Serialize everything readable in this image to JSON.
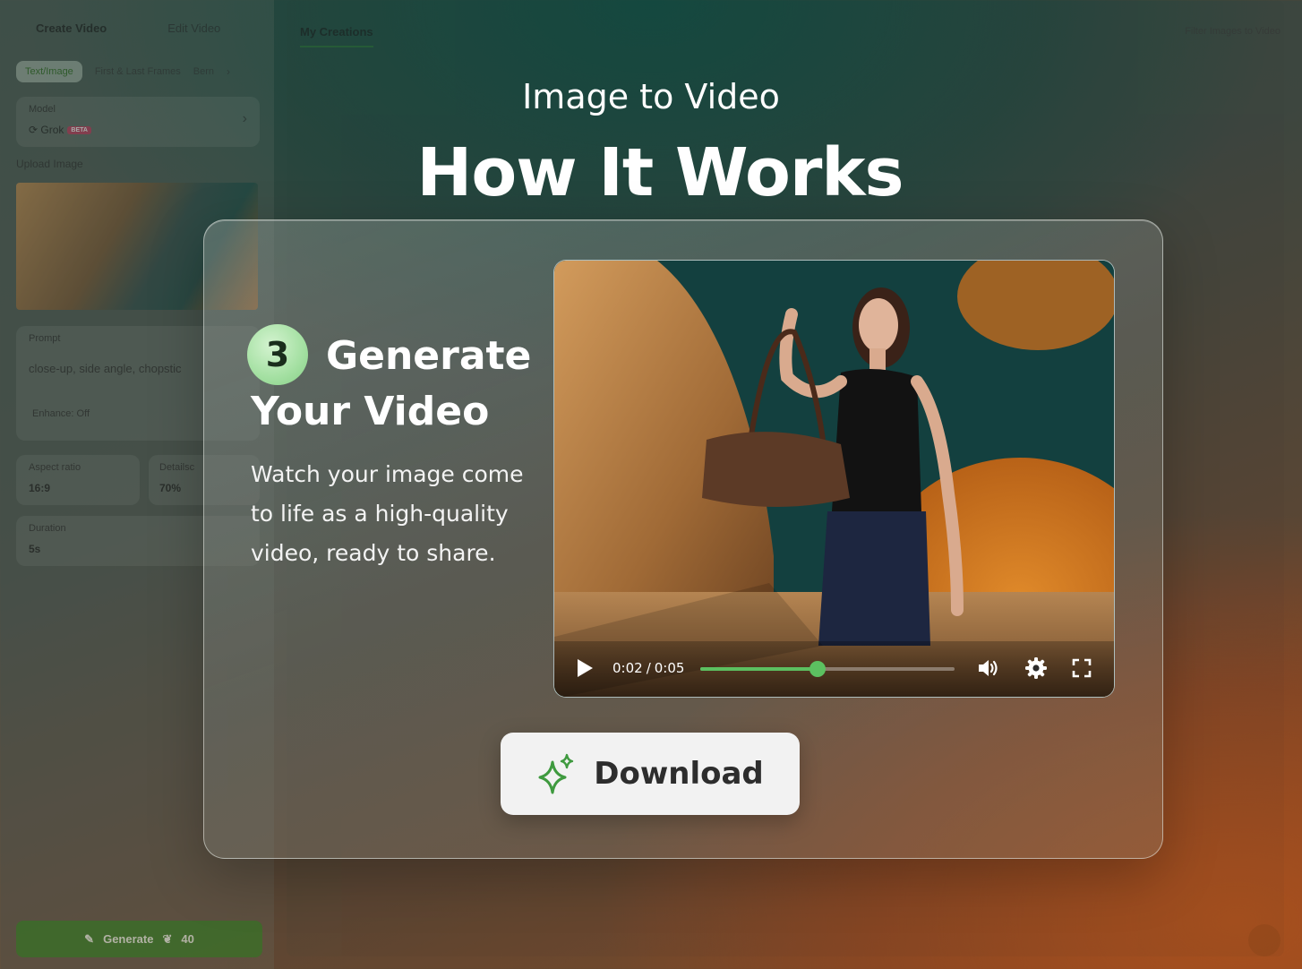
{
  "left_panel": {
    "tabs": [
      "Create Video",
      "Edit Video"
    ],
    "subtabs": [
      "Text/Image",
      "First & Last Frames",
      "Bern"
    ],
    "model": {
      "label": "Model",
      "value": "Grok",
      "badge": "BETA"
    },
    "upload_label": "Upload Image",
    "prompt": {
      "label": "Prompt",
      "text": "close-up, side angle, chopstic",
      "enhance": "Enhance: Off"
    },
    "aspect": {
      "label": "Aspect ratio",
      "value": "16:9"
    },
    "detail": {
      "label": "Detailsc",
      "value": "70%"
    },
    "duration": {
      "label": "Duration",
      "value": "5s"
    },
    "generate": {
      "label": "Generate",
      "cost": "40"
    }
  },
  "main": {
    "tab": "My Creations",
    "filter": "Filter Images to Video"
  },
  "hero": {
    "subtitle": "Image to Video",
    "title": "How It Works"
  },
  "step": {
    "number": "3",
    "title_line1": "Generate",
    "title_line2": "Your Video",
    "description": "Watch your image come to life as a high-quality video, ready to share."
  },
  "player": {
    "current_time": "0:02",
    "separator": "/",
    "total_time": "0:05",
    "progress_fraction": 0.46
  },
  "download": {
    "label": "Download"
  },
  "colors": {
    "accent": "#5cc060",
    "badge": "#a4e0a2"
  }
}
